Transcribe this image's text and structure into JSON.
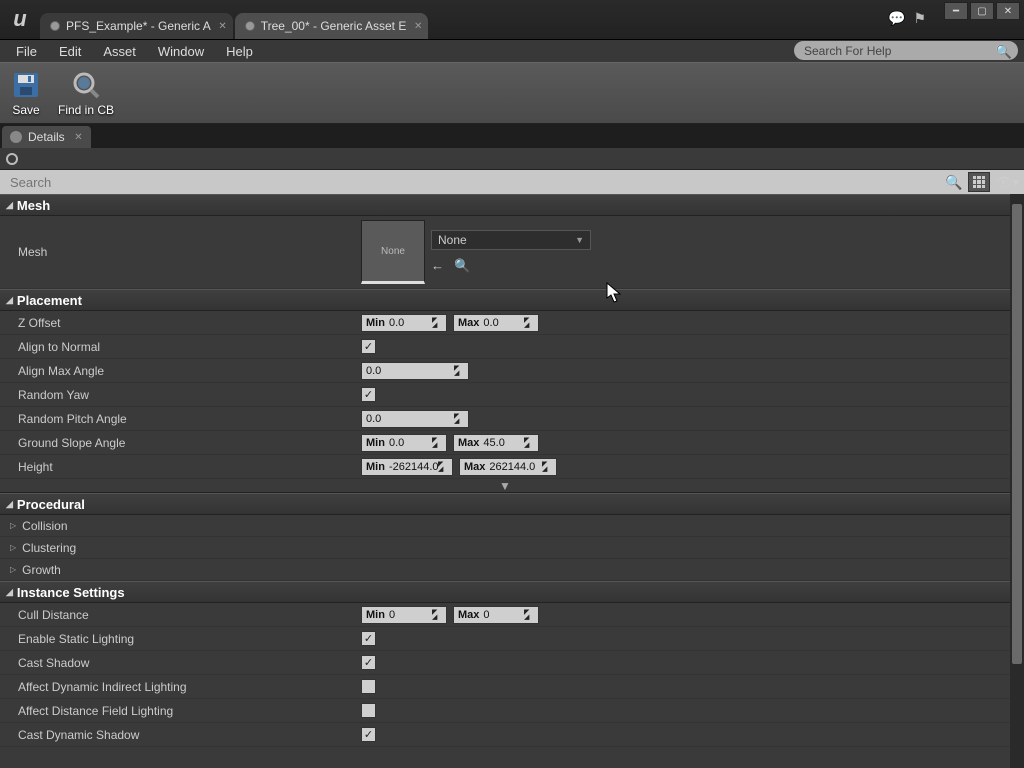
{
  "tabs": [
    {
      "label": "PFS_Example* - Generic A",
      "active": false
    },
    {
      "label": "Tree_00* - Generic Asset E",
      "active": true
    }
  ],
  "menu": {
    "file": "File",
    "edit": "Edit",
    "asset": "Asset",
    "window": "Window",
    "help": "Help"
  },
  "help_search_placeholder": "Search For Help",
  "toolbar": {
    "save": "Save",
    "find": "Find in CB"
  },
  "panel_tab": "Details",
  "search_placeholder": "Search",
  "sections": {
    "mesh": {
      "title": "Mesh",
      "row_label": "Mesh",
      "thumb_text": "None",
      "dropdown": "None"
    },
    "placement": {
      "title": "Placement",
      "z_offset": {
        "label": "Z Offset",
        "min": "0.0",
        "max": "0.0"
      },
      "align_normal": {
        "label": "Align to Normal",
        "checked": true
      },
      "align_max_angle": {
        "label": "Align Max Angle",
        "val": "0.0"
      },
      "random_yaw": {
        "label": "Random Yaw",
        "checked": true
      },
      "random_pitch": {
        "label": "Random Pitch Angle",
        "val": "0.0"
      },
      "ground_slope": {
        "label": "Ground Slope Angle",
        "min": "0.0",
        "max": "45.0"
      },
      "height": {
        "label": "Height",
        "min": "-262144.0",
        "max": "262144.0"
      }
    },
    "procedural": {
      "title": "Procedural",
      "items": [
        "Collision",
        "Clustering",
        "Growth"
      ]
    },
    "instance": {
      "title": "Instance Settings",
      "cull": {
        "label": "Cull Distance",
        "min": "0",
        "max": "0"
      },
      "static_light": {
        "label": "Enable Static Lighting",
        "checked": true
      },
      "cast_shadow": {
        "label": "Cast Shadow",
        "checked": true
      },
      "dyn_indirect": {
        "label": "Affect Dynamic Indirect Lighting",
        "checked": false
      },
      "dist_field": {
        "label": "Affect Distance Field Lighting",
        "checked": false
      },
      "cast_dyn": {
        "label": "Cast Dynamic Shadow",
        "checked": true
      }
    }
  },
  "spin_labels": {
    "min": "Min",
    "max": "Max"
  }
}
